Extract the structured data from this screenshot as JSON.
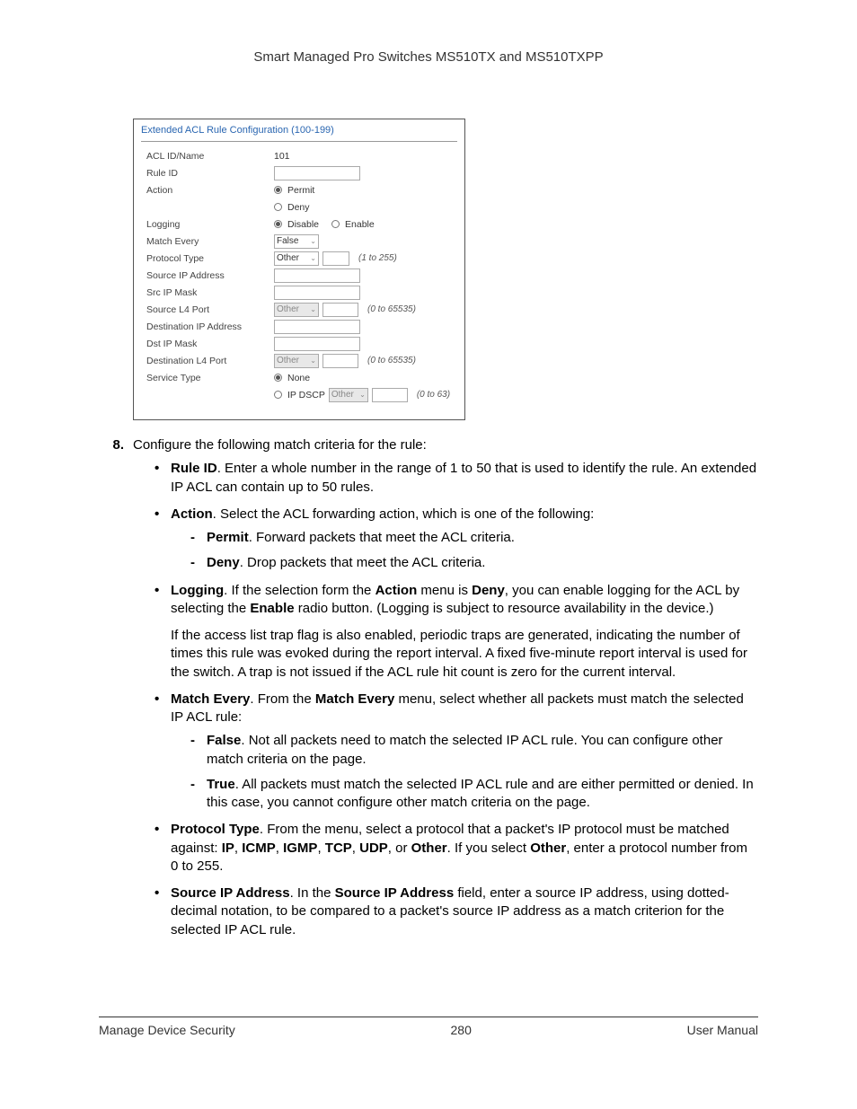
{
  "header": {
    "title": "Smart Managed Pro Switches MS510TX and MS510TXPP"
  },
  "screenshot": {
    "title": "Extended ACL Rule Configuration (100-199)",
    "rows": {
      "acl_id_name_label": "ACL ID/Name",
      "acl_id_name_value": "101",
      "rule_id_label": "Rule ID",
      "action_label": "Action",
      "action_permit": "Permit",
      "action_deny": "Deny",
      "logging_label": "Logging",
      "logging_disable": "Disable",
      "logging_enable": "Enable",
      "match_every_label": "Match Every",
      "match_every_value": "False",
      "protocol_type_label": "Protocol Type",
      "protocol_type_value": "Other",
      "protocol_type_hint": "(1 to 255)",
      "source_ip_label": "Source IP Address",
      "src_ip_mask_label": "Src IP Mask",
      "source_l4_label": "Source L4 Port",
      "source_l4_value": "Other",
      "source_l4_hint": "(0 to 65535)",
      "dest_ip_label": "Destination IP Address",
      "dst_ip_mask_label": "Dst IP Mask",
      "dest_l4_label": "Destination L4 Port",
      "dest_l4_value": "Other",
      "dest_l4_hint": "(0 to 65535)",
      "service_type_label": "Service Type",
      "service_type_none": "None",
      "service_type_ipdscp": "IP DSCP",
      "service_type_ipdscp_value": "Other",
      "service_type_ipdscp_hint": "(0 to 63)"
    }
  },
  "body": {
    "step_num": "8.",
    "step_text": "Configure the following match criteria for the rule:",
    "bullets": {
      "rule_id_b": "Rule ID",
      "rule_id_t": ". Enter a whole number in the range of 1 to 50 that is used to identify the rule. An extended IP ACL can contain up to 50 rules.",
      "action_b": "Action",
      "action_t": ". Select the ACL forwarding action, which is one of the following:",
      "permit_b": "Permit",
      "permit_t": ". Forward packets that meet the ACL criteria.",
      "deny_b": "Deny",
      "deny_t": ". Drop packets that meet the ACL criteria.",
      "logging_b": "Logging",
      "logging_t1": ". If the selection form the ",
      "logging_t2": "Action",
      "logging_t3": " menu is ",
      "logging_t4": "Deny",
      "logging_t5": ", you can enable logging for the ACL by selecting the ",
      "logging_t6": "Enable",
      "logging_t7": " radio button. (Logging is subject to resource availability in the device.)",
      "logging_para": "If the access list trap flag is also enabled, periodic traps are generated, indicating the number of times this rule was evoked during the report interval. A fixed five-minute report interval is used for the switch. A trap is not issued if the ACL rule hit count is zero for the current interval.",
      "match_b": "Match Every",
      "match_t1": ". From the ",
      "match_t2": "Match Every",
      "match_t3": " menu, select whether all packets must match the selected IP ACL rule:",
      "false_b": "False",
      "false_t": ". Not all packets need to match the selected IP ACL rule. You can configure other match criteria on the page.",
      "true_b": "True",
      "true_t": ". All packets must match the selected IP ACL rule and are either permitted or denied. In this case, you cannot configure other match criteria on the page.",
      "protocol_b": "Protocol Type",
      "protocol_t1": ". From the menu, select a protocol that a packet's IP protocol must be matched against: ",
      "protocol_ip": "IP",
      "protocol_sep": ", ",
      "protocol_icmp": "ICMP",
      "protocol_igmp": "IGMP",
      "protocol_tcp": "TCP",
      "protocol_udp": "UDP",
      "protocol_or": ", or ",
      "protocol_other": "Other",
      "protocol_t2": ". If you select ",
      "protocol_other2": "Other",
      "protocol_t3": ", enter a protocol number from 0 to 255.",
      "src_b": "Source IP Address",
      "src_t1": ". In the ",
      "src_t2": "Source IP Address",
      "src_t3": " field, enter a source IP address, using dotted-decimal notation, to be compared to a packet's source IP address as a match criterion for the selected IP ACL rule."
    }
  },
  "footer": {
    "left": "Manage Device Security",
    "center": "280",
    "right": "User Manual"
  }
}
